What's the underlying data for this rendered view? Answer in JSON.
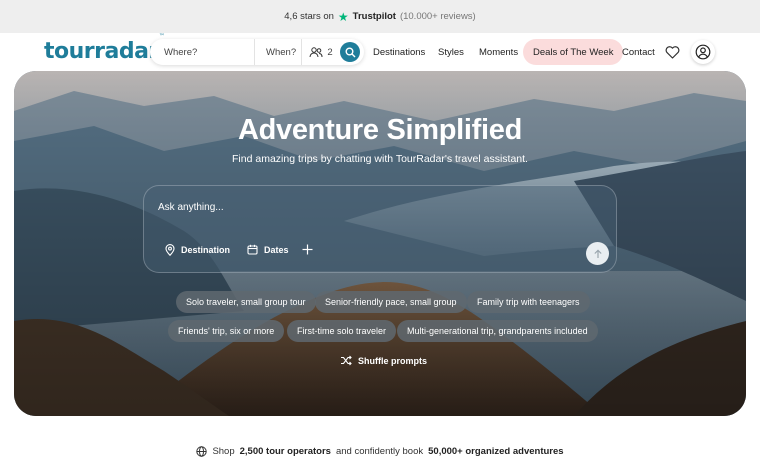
{
  "trustpilot": {
    "rating_text": "4,6 stars on",
    "brand": "Trustpilot",
    "reviews": "(10.000+ reviews)"
  },
  "nav": {
    "logo": "tourradar",
    "logo_tm": "™",
    "search": {
      "where_placeholder": "Where?",
      "when_placeholder": "When?",
      "travelers": "2"
    },
    "links": {
      "destinations": "Destinations",
      "styles": "Styles",
      "moments": "Moments",
      "deals": "Deals of The Week",
      "contact": "Contact"
    }
  },
  "hero": {
    "title": "Adventure Simplified",
    "subtitle": "Find amazing trips by chatting with TourRadar's travel assistant.",
    "chat": {
      "placeholder": "Ask anything...",
      "destination_label": "Destination",
      "dates_label": "Dates"
    },
    "prompts": [
      "Solo traveler, small group tour",
      "Senior-friendly pace, small group",
      "Family trip with teenagers",
      "Friends' trip, six or more",
      "First-time solo traveler",
      "Multi-generational trip, grandparents included"
    ],
    "shuffle_label": "Shuffle prompts"
  },
  "footer": {
    "prefix": "Shop",
    "operators": "2,500 tour operators",
    "middle": "and confidently book",
    "adventures": "50,000+ organized adventures"
  },
  "colors": {
    "brand": "#1f7d9a",
    "deals_bg": "#fbdcdc",
    "trustpilot_green": "#00b67a"
  }
}
